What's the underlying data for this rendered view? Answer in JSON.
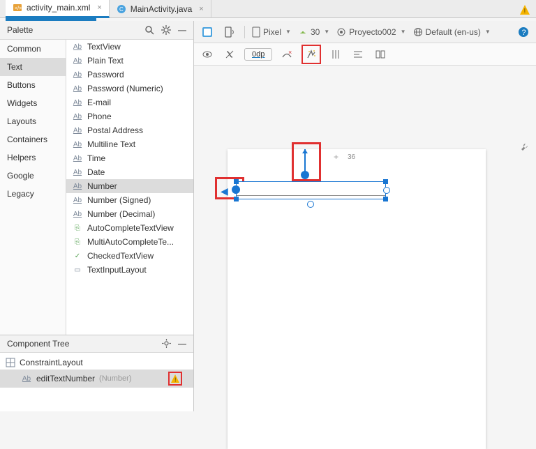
{
  "tabs": {
    "file1": "activity_main.xml",
    "file2": "MainActivity.java"
  },
  "palette": {
    "title": "Palette",
    "categories": [
      "Common",
      "Text",
      "Buttons",
      "Widgets",
      "Layouts",
      "Containers",
      "Helpers",
      "Google",
      "Legacy"
    ],
    "selectedCategory": "Text",
    "widgets": [
      {
        "icon": "Ab",
        "label": "TextView"
      },
      {
        "icon": "Ab",
        "label": "Plain Text"
      },
      {
        "icon": "Ab",
        "label": "Password"
      },
      {
        "icon": "Ab",
        "label": "Password (Numeric)"
      },
      {
        "icon": "Ab",
        "label": "E-mail"
      },
      {
        "icon": "Ab",
        "label": "Phone"
      },
      {
        "icon": "Ab",
        "label": "Postal Address"
      },
      {
        "icon": "Ab",
        "label": "Multiline Text"
      },
      {
        "icon": "Ab",
        "label": "Time"
      },
      {
        "icon": "Ab",
        "label": "Date"
      },
      {
        "icon": "Ab",
        "label": "Number",
        "selected": true
      },
      {
        "icon": "Ab",
        "label": "Number (Signed)"
      },
      {
        "icon": "Ab",
        "label": "Number (Decimal)"
      },
      {
        "icon": "auto",
        "label": "AutoCompleteTextView"
      },
      {
        "icon": "auto",
        "label": "MultiAutoCompleteTe..."
      },
      {
        "icon": "check",
        "label": "CheckedTextView"
      },
      {
        "icon": "layout",
        "label": "TextInputLayout"
      }
    ]
  },
  "componentTree": {
    "title": "Component Tree",
    "root": "ConstraintLayout",
    "child": {
      "id": "editTextNumber",
      "type": "(Number)"
    }
  },
  "designToolbar": {
    "device": "Pixel",
    "api": "30",
    "theme": "Proyecto002",
    "locale": "Default (en-us)",
    "marginDefault": "0dp",
    "constraintLabel": "36"
  }
}
